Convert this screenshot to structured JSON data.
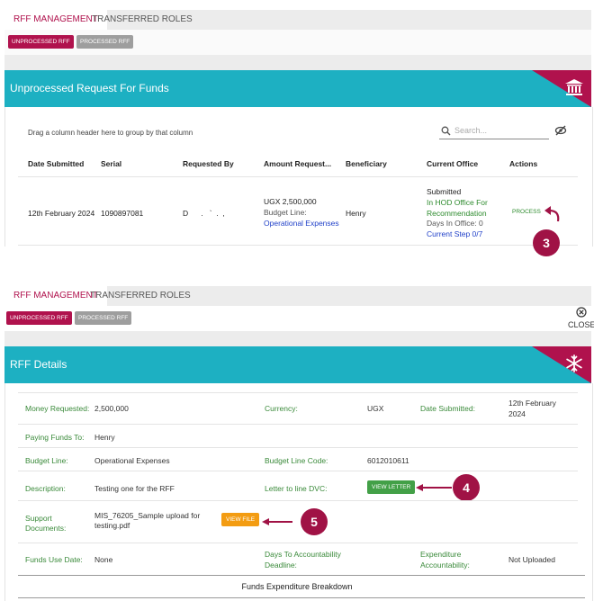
{
  "top_panel": {
    "tabs": [
      {
        "label": "RFF MANAGEMENT"
      },
      {
        "label": "TRANSFERRED ROLES"
      }
    ],
    "sub_buttons": [
      {
        "label": "UNPROCESSED RFF"
      },
      {
        "label": "PROCESSED RFF"
      }
    ],
    "header_title": "Unprocessed Request For Funds",
    "header_icon": "bank-icon",
    "drag_hint": "Drag a column header here to group by that column",
    "search_placeholder": "Search...",
    "columns": [
      "Date Submitted",
      "Serial",
      "Requested By",
      "Amount Request...",
      "Beneficiary",
      "Current Office",
      "Actions"
    ],
    "row": {
      "date": "12th February 2024",
      "serial": "1090897081",
      "requested_by": "D      .   `  .  ,",
      "amount": "UGX 2,500,000",
      "budget_line_label": "Budget Line:",
      "budget_line": "Operational Expenses",
      "beneficiary": "Henry",
      "office_status": "Submitted",
      "office_line1": "In HOD Office For",
      "office_line2": "Recommendation",
      "days_in_office": "Days In Office: 0",
      "current_step": "Current Step 0/7",
      "action": "PROCESS"
    },
    "badge": "3"
  },
  "bottom_panel": {
    "tabs": [
      {
        "label": "RFF MANAGEMENT"
      },
      {
        "label": "TRANSFERRED ROLES"
      }
    ],
    "sub_buttons": [
      {
        "label": "UNPROCESSED RFF"
      },
      {
        "label": "PROCESSED RFF"
      }
    ],
    "close_label": "CLOSE",
    "header_title": "RFF Details",
    "header_icon": "snowflake-icon",
    "details": {
      "money_requested_label": "Money Requested:",
      "money_requested": "2,500,000",
      "currency_label": "Currency:",
      "currency": "UGX",
      "date_submitted_label": "Date Submitted:",
      "date_submitted_1": "12th February",
      "date_submitted_2": "2024",
      "paying_funds_label": "Paying Funds To:",
      "paying_funds": "Henry",
      "budget_line_label": "Budget Line:",
      "budget_line": "Operational Expenses",
      "budget_code_label": "Budget Line Code:",
      "budget_code": "6012010611",
      "description_label": "Description:",
      "description": "Testing one for the RFF",
      "letter_label": "Letter to line DVC:",
      "view_letter": "VIEW LETTER",
      "support_label_1": "Support",
      "support_label_2": "Documents:",
      "support_file_1": "MIS_76205_Sample upload for",
      "support_file_2": "testing.pdf",
      "view_file": "VIEW FILE",
      "funds_use_label": "Funds Use Date:",
      "funds_use": "None",
      "days_acc_label_1": "Days To Accountability",
      "days_acc_label_2": "Deadline:",
      "exp_acc_label_1": "Expenditure",
      "exp_acc_label_2": "Accountability:",
      "exp_acc": "Not Uploaded"
    },
    "breakdown_title": "Funds Expenditure Breakdown",
    "badges": [
      "4",
      "5"
    ]
  },
  "colors": {
    "accent": "#b0124d",
    "teal": "#1db0c2",
    "green_button": "#43a047",
    "orange_button": "#f39c12",
    "label_green": "#3a8a3a",
    "link_blue": "#1f3fc8"
  }
}
